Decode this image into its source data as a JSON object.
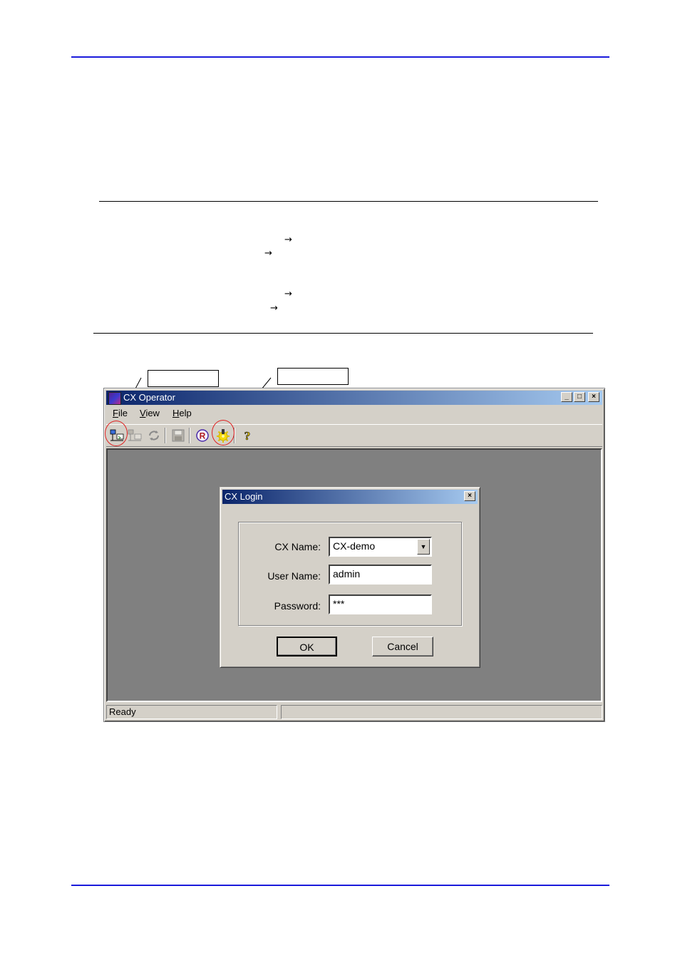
{
  "arrow_glyph": "→",
  "window": {
    "title": "CX Operator",
    "caption_buttons": [
      "_",
      "□",
      "×"
    ],
    "menu": [
      {
        "key": "F",
        "rest": "ile"
      },
      {
        "key": "V",
        "rest": "iew"
      },
      {
        "key": "H",
        "rest": "elp"
      }
    ],
    "toolbar": {
      "icons": [
        "login-icon",
        "logout-icon",
        "refresh-icon",
        "save-icon",
        "registered-icon",
        "settings-icon",
        "help-icon"
      ],
      "registered_glyph": "R",
      "help_glyph": "?"
    },
    "status": {
      "ready": "Ready",
      "pane2": ""
    }
  },
  "dialog": {
    "title": "CX Login",
    "close": "×",
    "fields": {
      "cx_name_label": "CX Name:",
      "cx_name_value": "CX-demo",
      "user_name_label": "User Name:",
      "user_name_value": "admin",
      "password_label": "Password:",
      "password_value": "***"
    },
    "combo_arrow": "▼",
    "ok": "OK",
    "cancel": "Cancel"
  },
  "colors": {
    "rule": "#1a1adb",
    "title_start": "#0a246a",
    "title_end": "#a6caf0",
    "highlight": "#e02020"
  }
}
